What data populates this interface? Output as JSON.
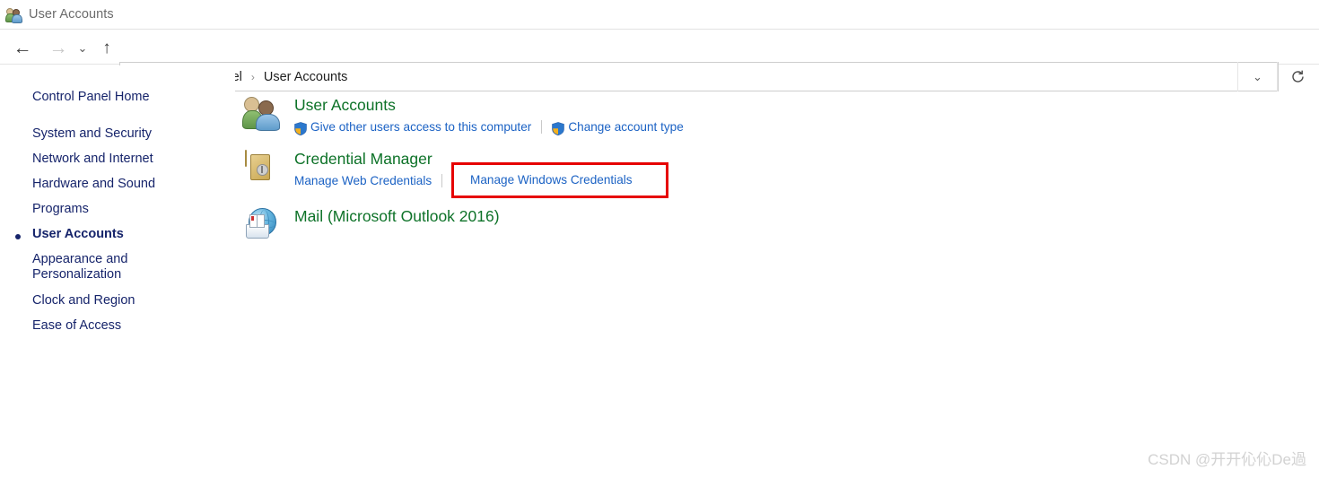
{
  "window": {
    "title": "User Accounts",
    "title_icon": "user-accounts-icon"
  },
  "navbar": {
    "back_icon": "←",
    "forward_icon": "→",
    "recent_icon": "⌄",
    "up_icon": "↑",
    "dropdown_icon": "⌄",
    "refresh_icon": "↻",
    "breadcrumb": {
      "icon": "user-accounts-icon",
      "separator": "›",
      "items": [
        {
          "label": "Control Panel"
        },
        {
          "label": "User Accounts"
        }
      ]
    }
  },
  "sidebar": {
    "items": [
      {
        "label": "Control Panel Home",
        "selected": false
      },
      {
        "label": "System and Security",
        "selected": false
      },
      {
        "label": "Network and Internet",
        "selected": false
      },
      {
        "label": "Hardware and Sound",
        "selected": false
      },
      {
        "label": "Programs",
        "selected": false
      },
      {
        "label": "User Accounts",
        "selected": true
      },
      {
        "label": "Appearance and\nPersonalization",
        "selected": false
      },
      {
        "label": "Clock and Region",
        "selected": false
      },
      {
        "label": "Ease of Access",
        "selected": false
      }
    ]
  },
  "content": {
    "categories": [
      {
        "icon": "user-accounts-icon",
        "title": "User Accounts",
        "links": [
          {
            "label": "Give other users access to this computer",
            "shield": true
          },
          {
            "label": "Change account type",
            "shield": true
          }
        ]
      },
      {
        "icon": "credential-safe-icon",
        "title": "Credential Manager",
        "links": [
          {
            "label": "Manage Web Credentials",
            "shield": false
          },
          {
            "label": "Manage Windows Credentials",
            "shield": false
          }
        ]
      },
      {
        "icon": "mail-icon",
        "title": "Mail (Microsoft Outlook 2016)",
        "links": []
      }
    ]
  },
  "highlight": {
    "label": "Manage Windows Credentials",
    "color": "#e60000"
  },
  "watermark": {
    "text": "CSDN @开开伈伈De過"
  },
  "colors": {
    "heading_green": "#0d7228",
    "link_blue": "#1b62c4",
    "sidebar_navy": "#16246b",
    "title_gray": "#6b6b6b"
  }
}
